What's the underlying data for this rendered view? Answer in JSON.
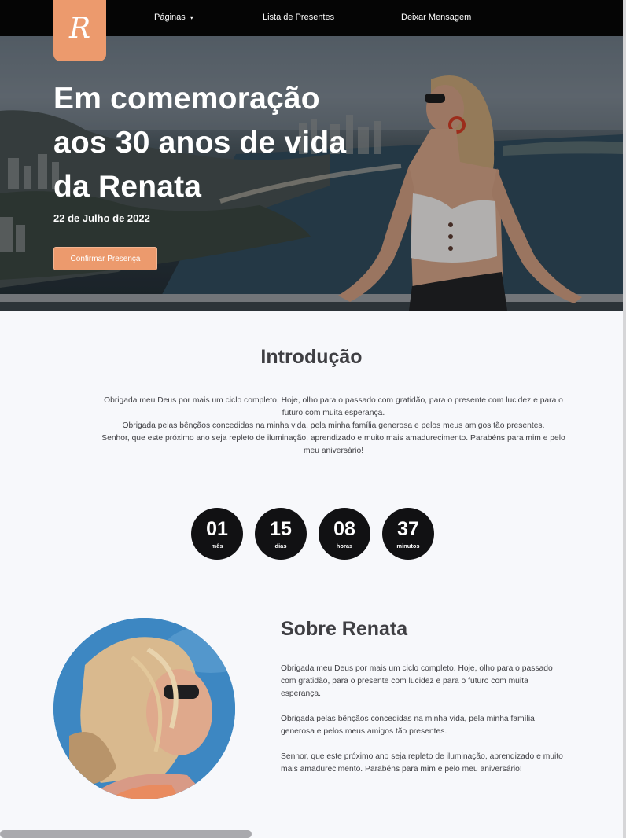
{
  "nav": {
    "logo_letter": "R",
    "items": [
      "Páginas",
      "Lista de Presentes",
      "Deixar Mensagem"
    ],
    "dropdown_caret": "▾"
  },
  "hero": {
    "title": "Em comemoração aos 30 anos de vida da Renata",
    "date": "22 de Julho de 2022",
    "confirm_label": "Confirmar Presença",
    "accent_color": "#ec9a6d"
  },
  "intro": {
    "title": "Introdução",
    "lines": [
      "Obrigada meu Deus por mais um ciclo completo. Hoje, olho para o passado com gratidão, para o presente com lucidez e para o futuro com muita esperança.",
      "Obrigada pelas bênçãos concedidas na minha vida, pela minha família generosa e pelos meus amigos tão presentes.",
      "Senhor, que este próximo ano seja repleto de iluminação, aprendizado e muito mais amadurecimento. Parabéns para mim e pelo meu aniversário!"
    ]
  },
  "countdown": [
    {
      "value": "01",
      "unit": "mês"
    },
    {
      "value": "15",
      "unit": "dias"
    },
    {
      "value": "08",
      "unit": "horas"
    },
    {
      "value": "37",
      "unit": "minutos"
    }
  ],
  "about": {
    "title": "Sobre Renata",
    "paragraphs": [
      "Obrigada meu Deus por mais um ciclo completo. Hoje, olho para o passado com gratidão, para o presente com lucidez e para o futuro com muita esperança.",
      "Obrigada pelas bênçãos concedidas na minha vida, pela minha família generosa e pelos meus amigos tão presentes.",
      "Senhor, que este próximo ano seja repleto de iluminação, aprendizado e muito mais amadurecimento. Parabéns para mim e pelo meu aniversário!"
    ]
  }
}
